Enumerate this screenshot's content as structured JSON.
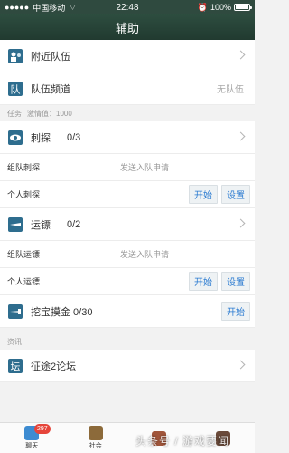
{
  "status_bar": {
    "carrier": "中国移动",
    "time": "22:48",
    "battery": "100%"
  },
  "header": {
    "title": "辅助"
  },
  "team": {
    "nearby_label": "附近队伍",
    "channel_label": "队伍频道",
    "channel_status": "无队伍"
  },
  "tasks_section": {
    "title": "任务",
    "vigor": "激情值：1000"
  },
  "spy": {
    "label": "刺探",
    "count": "0/3",
    "team_label": "组队刺探",
    "team_status": "发送入队申请",
    "solo_label": "个人刺探",
    "start": "开始",
    "settings": "设置"
  },
  "escort": {
    "label": "运镖",
    "count": "0/2",
    "team_label": "组队运镖",
    "team_status": "发送入队申请",
    "solo_label": "个人运镖",
    "start": "开始",
    "settings": "设置"
  },
  "treasure": {
    "label": "挖宝摸金 0/30",
    "start": "开始"
  },
  "info_section": {
    "title": "资讯"
  },
  "forum": {
    "label": "征途2论坛"
  },
  "tabbar": {
    "chat_label": "聊天",
    "chat_badge": "297",
    "social_label": "社会"
  },
  "watermark": "头条号 / 游戏要闻",
  "colors": {
    "header": "#2d4d3f",
    "button_text": "#2b7bd1",
    "badge": "#e6453a"
  }
}
